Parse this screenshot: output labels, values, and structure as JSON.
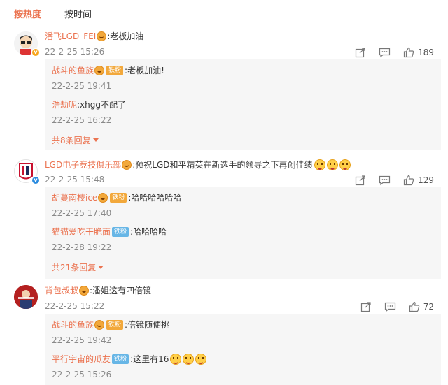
{
  "tabs": [
    {
      "label": "按热度",
      "active": true
    },
    {
      "label": "按时间",
      "active": false
    }
  ],
  "comments": [
    {
      "user": "潘飞LGD_FEI",
      "text": ":老板加油",
      "time": "22-2-25 15:26",
      "likes": "189",
      "replies": [
        {
          "user": "战斗的鱼族",
          "tag": "铁粉",
          "text": ":老板加油!",
          "time": "22-2-25 19:41"
        },
        {
          "user": "浩劫呢",
          "text": ":xhgg不配了",
          "time": "22-2-25 16:22"
        }
      ],
      "more": "共8条回复"
    },
    {
      "user": "LGD电子竞技俱乐部",
      "text": ":预祝LGD和平精英在新选手的领导之下再创佳绩",
      "time": "22-2-25 15:48",
      "likes": "129",
      "replies": [
        {
          "user": "胡蔓南枝ice",
          "tag": "铁粉",
          "text": ":哈哈哈哈哈哈",
          "time": "22-2-25 17:40"
        },
        {
          "user": "猫猫爱吃干脆面",
          "tag": "铁粉",
          "text": ":哈哈哈哈",
          "time": "22-2-28 19:22"
        }
      ],
      "more": "共21条回复"
    },
    {
      "user": "背包叔叔",
      "text": ":潘姐这有四倍镜",
      "time": "22-2-25 15:22",
      "likes": "72",
      "replies": [
        {
          "user": "战斗的鱼族",
          "tag": "铁粉",
          "text": ":倍镜随便挑",
          "time": "22-2-25 19:42"
        },
        {
          "user": "平行宇宙的瓜友",
          "tag": "铁粉",
          "text": ":这里有16",
          "time": "22-2-25 15:26"
        }
      ]
    }
  ],
  "colors": {
    "accent": "#eb7350",
    "reply_bg": "#f6f6f6",
    "time": "#8a8a8a"
  },
  "icons": [
    "share-icon",
    "comment-icon",
    "like-icon",
    "fan-badge-icon",
    "emoji-icon",
    "verified-icon"
  ]
}
